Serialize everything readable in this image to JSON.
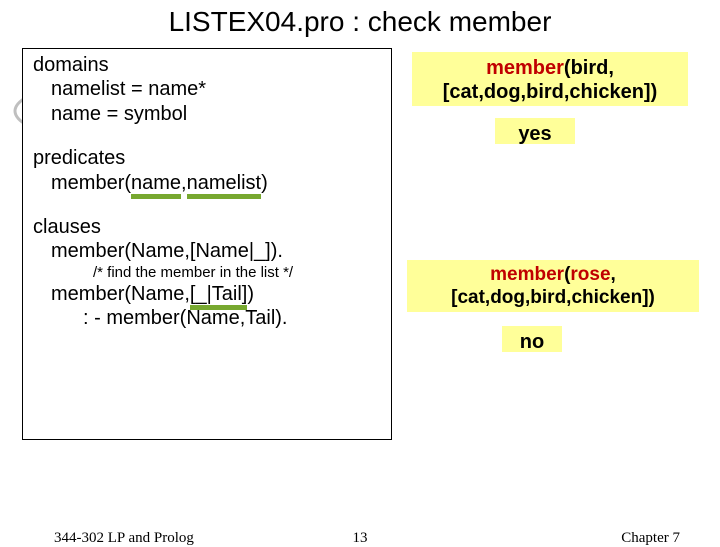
{
  "title": "LISTEX04.pro : check member",
  "code": {
    "domains_kw": "domains",
    "domains_l1": "namelist = name*",
    "domains_l2": "name = symbol",
    "predicates_kw": "predicates",
    "predicates_l1_a": "member(",
    "predicates_l1_b": "name",
    "predicates_l1_c": ",",
    "predicates_l1_d": "namelist",
    "predicates_l1_e": ")",
    "clauses_kw": "clauses",
    "clauses_l1": "member(Name,[Name|_]).",
    "comment": "/* find the member in the list */",
    "clauses_l2a": "member(Name,",
    "clauses_l2b": "[_|Tail]",
    "clauses_l2c": ")",
    "clauses_l3": ": - member(Name,Tail)."
  },
  "q1_member": "member",
  "q1_rest": "(bird,[cat,dog,bird,chicken])",
  "a1": "yes",
  "q2_member": "member",
  "q2_paren": "(",
  "q2_rose": "rose",
  "q2_rest": ",[cat,dog,bird,chicken])",
  "a2": "no",
  "footer": {
    "left": "344-302 LP and Prolog",
    "center": "13",
    "right": "Chapter 7"
  }
}
